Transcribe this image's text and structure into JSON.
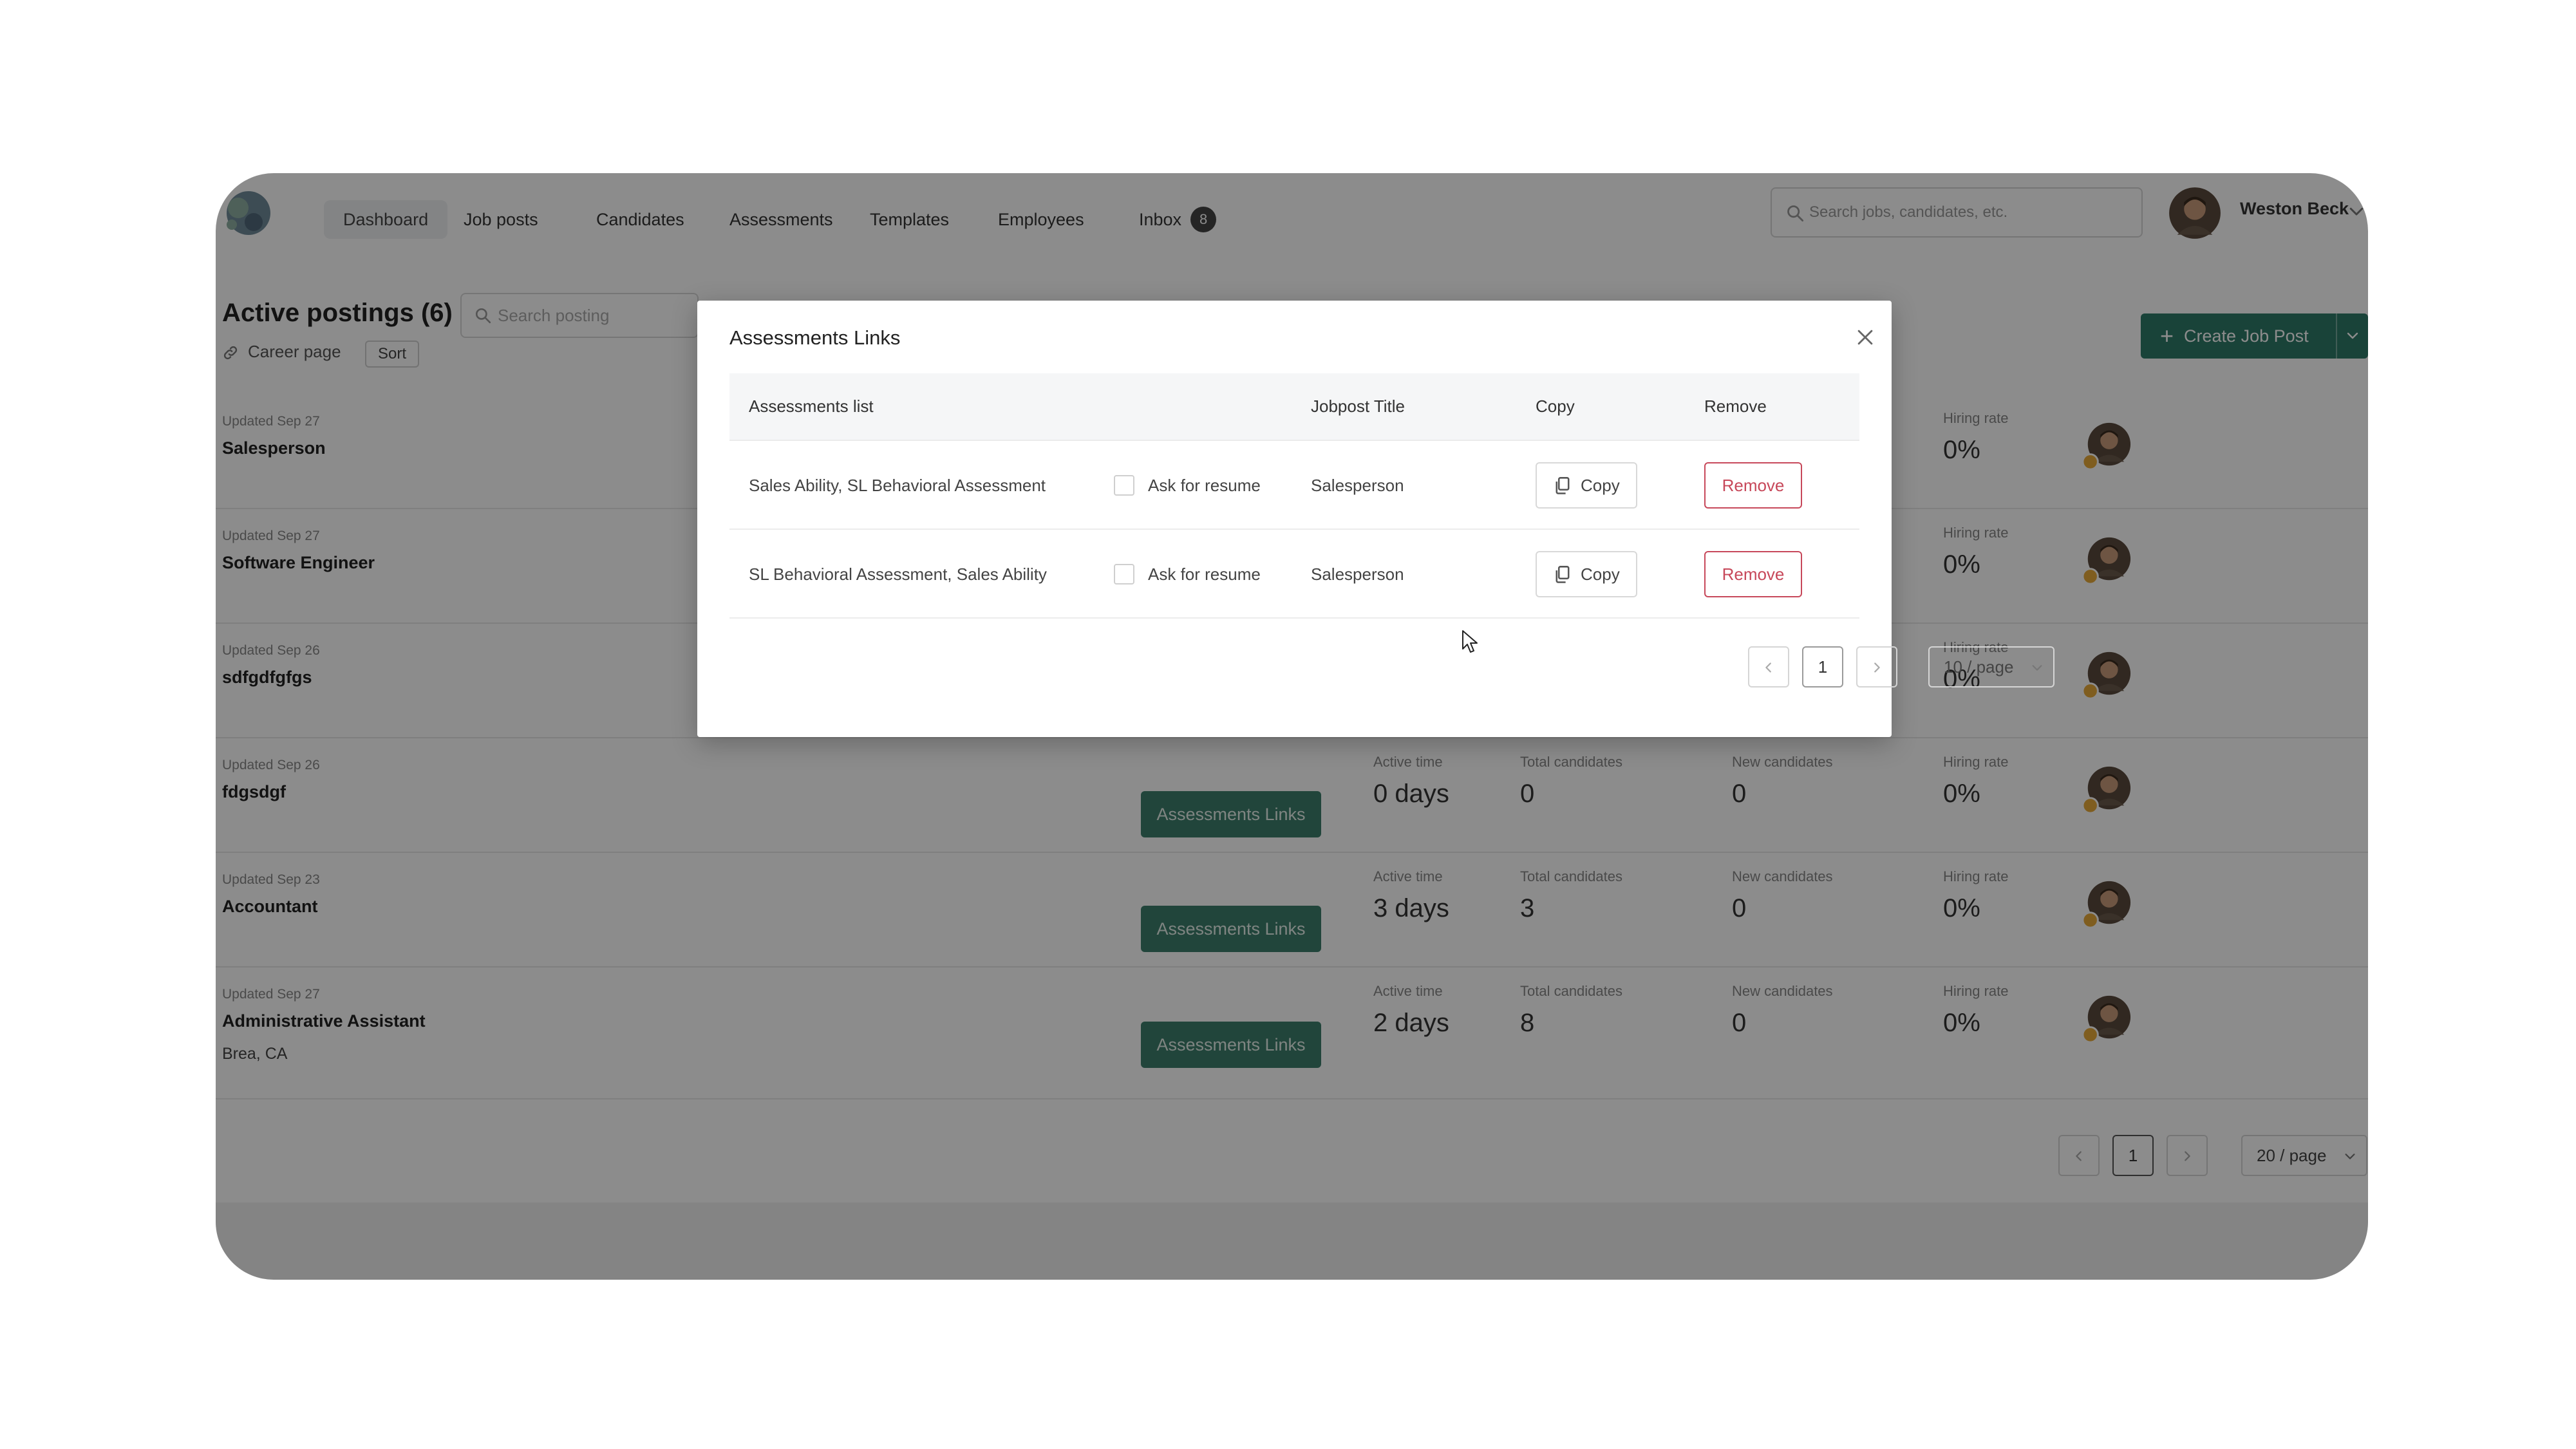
{
  "nav": {
    "items": [
      {
        "label": "Dashboard",
        "active": true
      },
      {
        "label": "Job posts"
      },
      {
        "label": "Candidates"
      },
      {
        "label": "Assessments"
      },
      {
        "label": "Templates"
      },
      {
        "label": "Employees"
      }
    ],
    "inbox": {
      "label": "Inbox",
      "count": "8"
    },
    "search_placeholder": "Search jobs, candidates, etc.",
    "user_name": "Weston Beck"
  },
  "page": {
    "title": "Active postings (6)",
    "search_placeholder": "Search posting",
    "career_link": "Career page",
    "sort_label": "Sort",
    "create_label": "Create Job Post"
  },
  "stat_labels": {
    "active_time": "Active time",
    "total_candidates": "Total candidates",
    "new_candidates": "New candidates",
    "hiring_rate": "Hiring rate"
  },
  "postings": [
    {
      "updated": "Updated Sep 27",
      "title": "Salesperson",
      "hiring_rate": "0%"
    },
    {
      "updated": "Updated Sep 27",
      "title": "Software Engineer",
      "hiring_rate": "0%"
    },
    {
      "updated": "Updated Sep 26",
      "title": "sdfgdfgfgs",
      "hiring_rate": "0%"
    },
    {
      "updated": "Updated Sep 26",
      "title": "fdgsdgf",
      "button": "Assessments Links",
      "active_time": "0 days",
      "total_candidates": "0",
      "new_candidates": "0",
      "hiring_rate": "0%"
    },
    {
      "updated": "Updated Sep 23",
      "title": "Accountant",
      "button": "Assessments Links",
      "active_time": "3 days",
      "total_candidates": "3",
      "new_candidates": "0",
      "hiring_rate": "0%"
    },
    {
      "updated": "Updated Sep 27",
      "title": "Administrative Assistant",
      "location": "Brea, CA",
      "button": "Assessments Links",
      "active_time": "2 days",
      "total_candidates": "8",
      "new_candidates": "0",
      "hiring_rate": "0%"
    }
  ],
  "bottom_pagination": {
    "current": "1",
    "page_size": "20 / page"
  },
  "modal": {
    "title": "Assessments Links",
    "columns": {
      "assessments": "Assessments list",
      "jobpost": "Jobpost Title",
      "copy": "Copy",
      "remove": "Remove"
    },
    "rows": [
      {
        "assessments": "Sales Ability, SL Behavioral Assessment",
        "ask_resume": "Ask for resume",
        "jobpost": "Salesperson",
        "copy": "Copy",
        "remove": "Remove"
      },
      {
        "assessments": "SL Behavioral Assessment, Sales Ability",
        "ask_resume": "Ask for resume",
        "jobpost": "Salesperson",
        "copy": "Copy",
        "remove": "Remove"
      }
    ],
    "pagination": {
      "current": "1",
      "page_size": "10 / page"
    }
  },
  "colors": {
    "brand_green": "#2f7a68",
    "danger": "#c7485a",
    "overlay": "rgba(0,0,0,0.45)"
  },
  "icons": [
    "logo-icon",
    "search-icon",
    "chevron-down-icon",
    "link-icon",
    "plus-icon",
    "copy-icon",
    "close-icon",
    "chevron-left-icon",
    "chevron-right-icon",
    "cursor-icon"
  ]
}
